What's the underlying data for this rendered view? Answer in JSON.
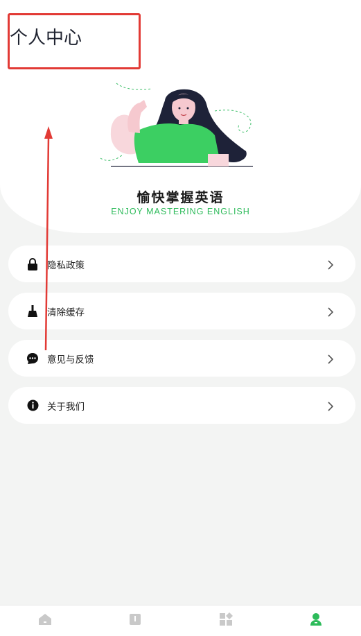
{
  "header": {
    "title": "个人中心"
  },
  "hero": {
    "app_name": "愉快掌握英语",
    "slogan": "ENJOY MASTERING ENGLISH"
  },
  "menu": [
    {
      "label": "隐私政策",
      "icon": "lock-icon"
    },
    {
      "label": "清除缓存",
      "icon": "broom-icon"
    },
    {
      "label": "意见与反馈",
      "icon": "chat-bubble-icon"
    },
    {
      "label": "关于我们",
      "icon": "info-icon"
    }
  ],
  "tabbar": {
    "tabs": [
      {
        "icon": "home-icon",
        "active": false
      },
      {
        "icon": "book-icon",
        "active": false
      },
      {
        "icon": "apps-icon",
        "active": false
      },
      {
        "icon": "profile-icon",
        "active": true
      }
    ]
  },
  "colors": {
    "accent": "#2dbb5a",
    "annotation": "#e23a35",
    "background": "#f3f4f3"
  }
}
